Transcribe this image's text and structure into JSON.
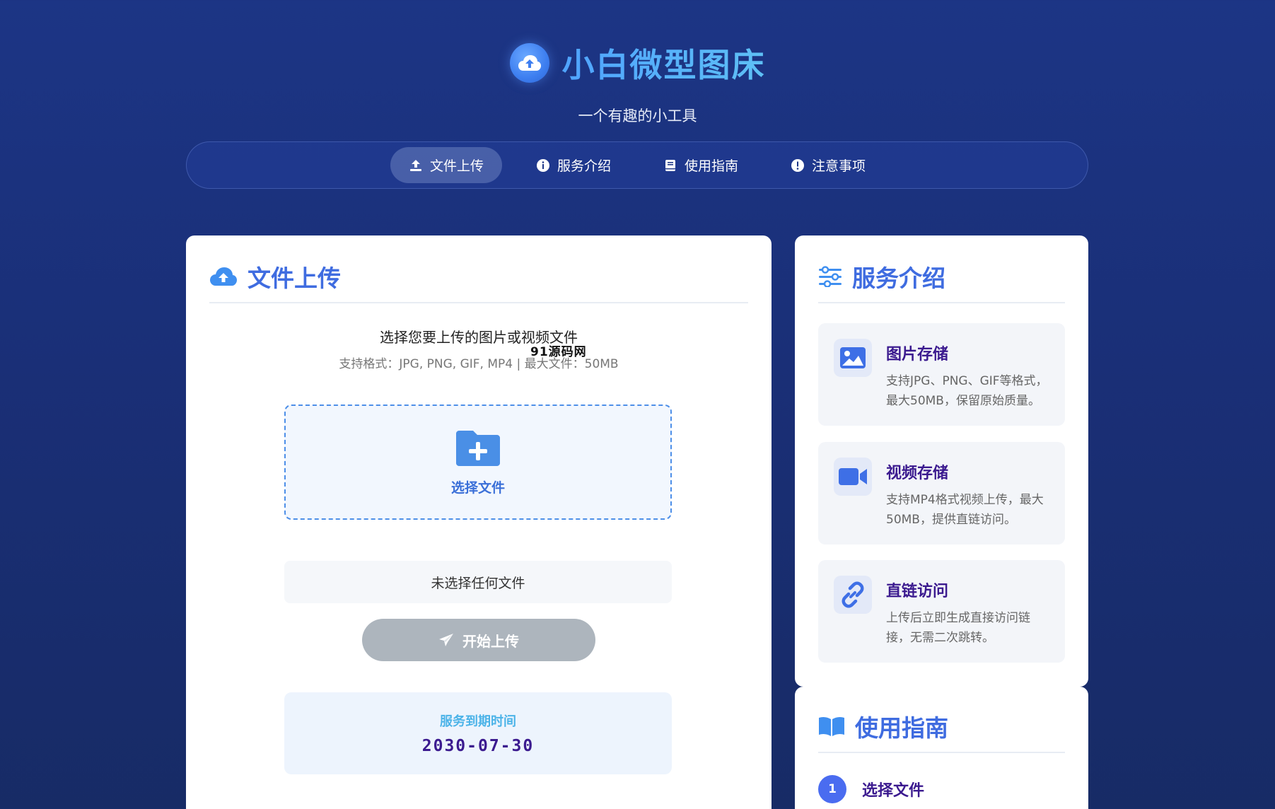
{
  "header": {
    "title": "小白微型图床",
    "subtitle": "一个有趣的小工具"
  },
  "nav": {
    "items": [
      {
        "label": "文件上传",
        "icon": "upload-icon",
        "active": true
      },
      {
        "label": "服务介绍",
        "icon": "info-icon",
        "active": false
      },
      {
        "label": "使用指南",
        "icon": "book-icon",
        "active": false
      },
      {
        "label": "注意事项",
        "icon": "alert-icon",
        "active": false
      }
    ]
  },
  "upload": {
    "title": "文件上传",
    "intro": "选择您要上传的图片或视频文件",
    "formats": "支持格式：JPG, PNG, GIF, MP4 | 最大文件：50MB",
    "watermark": "91源码网",
    "dropzone_label": "选择文件",
    "file_status": "未选择任何文件",
    "button_label": "开始上传",
    "expiry_label": "服务到期时间",
    "expiry_value": "2030-07-30"
  },
  "service": {
    "title": "服务介绍",
    "features": [
      {
        "title": "图片存储",
        "desc": "支持JPG、PNG、GIF等格式，最大50MB，保留原始质量。",
        "icon": "image-icon"
      },
      {
        "title": "视频存储",
        "desc": "支持MP4格式视频上传，最大50MB，提供直链访问。",
        "icon": "video-icon"
      },
      {
        "title": "直链访问",
        "desc": "上传后立即生成直接访问链接，无需二次跳转。",
        "icon": "link-icon"
      }
    ]
  },
  "guide": {
    "title": "使用指南",
    "steps": [
      {
        "num": "1",
        "label": "选择文件"
      }
    ]
  },
  "colors": {
    "accent": "#3f6ce0",
    "feature_title": "#3b1a8f",
    "button_disabled": "#adb5bd"
  }
}
